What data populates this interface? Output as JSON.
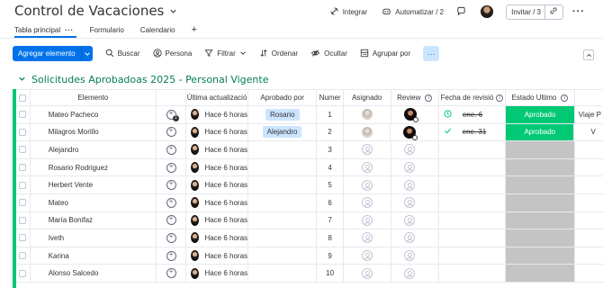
{
  "board": {
    "title": "Control de Vacaciones"
  },
  "top_actions": {
    "integrate": "Integrar",
    "automate": "Automatizar / 2",
    "invite": "Invitar / 3"
  },
  "tabs": [
    {
      "label": "Tabla principal"
    },
    {
      "label": "Formulario"
    },
    {
      "label": "Calendario"
    }
  ],
  "toolbar": {
    "add_item": "Agregar elemento",
    "search": "Buscar",
    "person": "Persona",
    "filter": "Filtrar",
    "sort": "Ordenar",
    "hide": "Ocultar",
    "group_by": "Agrupar por"
  },
  "group": {
    "title": "Solicitudes Aprobadoas 2025 - Personal Vigente",
    "color": "#037f4c"
  },
  "columns": {
    "element": "Elemento",
    "last_update": "Última actualizació",
    "approved_by": "Aprobado por",
    "number": "Numer",
    "assigned": "Asignado",
    "review": "Review",
    "request_date": "Fecha de revisió",
    "status": "Estado Ultimo"
  },
  "rows": [
    {
      "name": "Mateo Pacheco",
      "update": "Hace 6 horas",
      "approved_by": "Rosario",
      "number": "1",
      "date": "ene. 6",
      "status": "Aprobado",
      "extra": "Viaje P"
    },
    {
      "name": "Milagros Morillo",
      "update": "Hace 6 horas",
      "approved_by": "Alejandro",
      "number": "2",
      "date": "ene. 31",
      "status": "Aprobado",
      "extra": "V"
    },
    {
      "name": "Alejandro",
      "update": "Hace 6 horas",
      "approved_by": "",
      "number": "3",
      "date": "",
      "status": "",
      "extra": ""
    },
    {
      "name": "Rosario Rodriguez",
      "update": "Hace 6 horas",
      "approved_by": "",
      "number": "4",
      "date": "",
      "status": "",
      "extra": ""
    },
    {
      "name": "Herbert Vente",
      "update": "Hace 6 horas",
      "approved_by": "",
      "number": "5",
      "date": "",
      "status": "",
      "extra": ""
    },
    {
      "name": "Mateo",
      "update": "Hace 6 horas",
      "approved_by": "",
      "number": "6",
      "date": "",
      "status": "",
      "extra": ""
    },
    {
      "name": "María Bonifaz",
      "update": "Hace 6 horas",
      "approved_by": "",
      "number": "7",
      "date": "",
      "status": "",
      "extra": ""
    },
    {
      "name": "Iveth",
      "update": "Hace 6 horas",
      "approved_by": "",
      "number": "8",
      "date": "",
      "status": "",
      "extra": ""
    },
    {
      "name": "Karina",
      "update": "Hace 6 horas",
      "approved_by": "",
      "number": "9",
      "date": "",
      "status": "",
      "extra": ""
    },
    {
      "name": "Alonso Salcedo",
      "update": "Hace 6 horas",
      "approved_by": "",
      "number": "10",
      "date": "",
      "status": "",
      "extra": ""
    }
  ],
  "colors": {
    "primary": "#0073ea",
    "approved": "#00c875",
    "empty_status": "#c4c4c4",
    "label_bg": "#cce5ff"
  }
}
